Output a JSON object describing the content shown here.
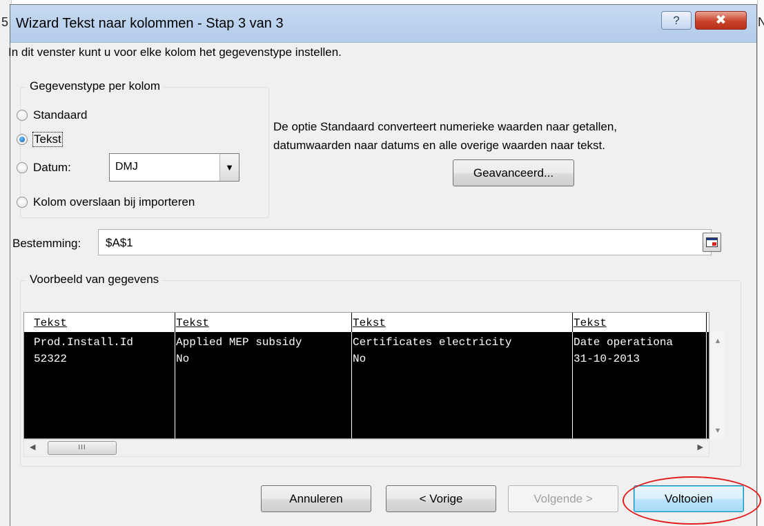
{
  "background": {
    "left_fragment": "5",
    "right_fragment": "N"
  },
  "dialog": {
    "title": "Wizard Tekst naar kolommen - Stap 3 van 3",
    "help_button": "?",
    "close_button": "✖",
    "intro": "In dit venster kunt u voor elke kolom het gegevenstype instellen."
  },
  "datatype_group": {
    "legend": "Gegevenstype per kolom",
    "options": [
      {
        "label": "Standaard",
        "checked": false
      },
      {
        "label": "Tekst",
        "checked": true
      },
      {
        "label": "Datum:",
        "checked": false
      },
      {
        "label": "Kolom overslaan bij importeren",
        "checked": false
      }
    ],
    "date_format": "DMJ"
  },
  "info": {
    "line1": "De optie Standaard converteert numerieke waarden naar getallen,",
    "line2": "datumwaarden naar datums en alle overige waarden naar tekst.",
    "advanced_button": "Geavanceerd..."
  },
  "destination": {
    "label": "Bestemming:",
    "value": "$A$1"
  },
  "preview": {
    "legend": "Voorbeeld van gegevens",
    "headers": [
      "Tekst",
      "Tekst",
      "Tekst",
      "Tekst"
    ],
    "rows": [
      [
        "Prod.Install.Id",
        "Applied MEP subsidy",
        "Certificates electricity",
        "Date operationa"
      ],
      [
        "52322",
        "No",
        "No",
        "31-10-2013"
      ]
    ],
    "scroll_thumb": "III"
  },
  "buttons": {
    "cancel": "Annuleren",
    "previous": "< Vorige",
    "next": "Volgende >",
    "finish": "Voltooien"
  },
  "colors": {
    "highlight": "#e01b1b",
    "titlebar": "#c6daf2",
    "preview_background": "#000000"
  }
}
